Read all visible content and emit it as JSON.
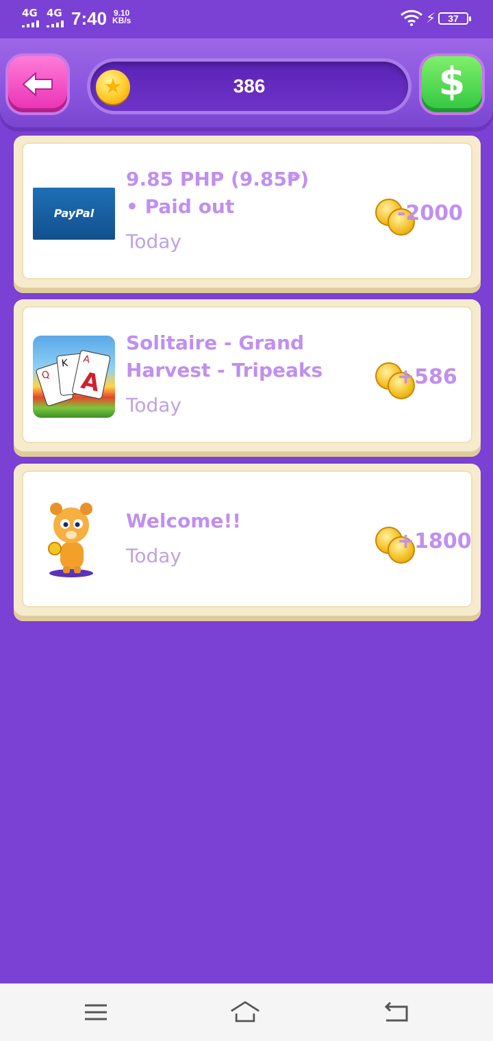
{
  "status_bar": {
    "network1": "4G",
    "network2": "4G",
    "time": "7:40",
    "speed_value": "9.10",
    "speed_unit": "KB/s",
    "battery": "37",
    "icons": [
      "signal-icon",
      "wifi-icon",
      "charging-icon",
      "battery-icon"
    ]
  },
  "header": {
    "back_icon": "back-arrow-icon",
    "balance": "386",
    "balance_icon": "star-coin-icon",
    "cashout_icon": "dollar-icon",
    "colors": {
      "band": "#8a55de",
      "back": "#ea2fb5",
      "cashout": "#2fc63f"
    }
  },
  "history": [
    {
      "thumb": "paypal-logo",
      "thumb_text": "PayPal",
      "title_line1": "9.85 PHP (9.85₱)",
      "title_line2": "• Paid out",
      "date": "Today",
      "amount": "-2000"
    },
    {
      "thumb": "solitaire-grand-harvest-icon",
      "title_line1": "Solitaire - Grand",
      "title_line2": "Harvest - Tripeaks",
      "date": "Today",
      "amount": "+586"
    },
    {
      "thumb": "bear-mascot",
      "title_line1": "Welcome!!",
      "date": "Today",
      "amount": "+1800"
    }
  ],
  "nav_bar": {
    "items": [
      "menu-icon",
      "home-icon",
      "back-icon"
    ]
  },
  "colors": {
    "background": "#7b40d4",
    "accent_text": "#c08ff0"
  }
}
